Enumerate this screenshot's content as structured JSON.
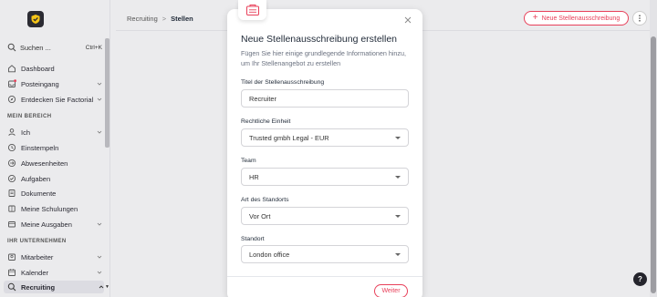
{
  "sidebar": {
    "search_label": "Suchen ...",
    "search_shortcut": "Ctrl+K",
    "items_top": [
      {
        "label": "Dashboard",
        "icon": "home-icon"
      },
      {
        "label": "Posteingang",
        "icon": "inbox-icon",
        "chevron": true,
        "dot": true
      },
      {
        "label": "Entdecken Sie Factorial",
        "icon": "compass-icon",
        "chevron": true
      }
    ],
    "section_mein": "MEIN BEREICH",
    "items_mein": [
      {
        "label": "Ich",
        "icon": "user-icon",
        "chevron": true
      },
      {
        "label": "Einstempeln",
        "icon": "clock-icon"
      },
      {
        "label": "Abwesenheiten",
        "icon": "plane-icon"
      },
      {
        "label": "Aufgaben",
        "icon": "check-circle-icon"
      },
      {
        "label": "Dokumente",
        "icon": "document-icon"
      },
      {
        "label": "Meine Schulungen",
        "icon": "book-icon"
      },
      {
        "label": "Meine Ausgaben",
        "icon": "receipt-icon",
        "chevron": true
      }
    ],
    "section_unternehmen": "IHR UNTERNEHMEN",
    "items_unternehmen": [
      {
        "label": "Mitarbeiter",
        "icon": "people-icon",
        "chevron": true
      },
      {
        "label": "Kalender",
        "icon": "calendar-icon",
        "chevron": true
      },
      {
        "label": "Recruiting",
        "icon": "search-person-icon",
        "chevron": true,
        "active": true
      }
    ]
  },
  "header": {
    "breadcrumb_parent": "Recruiting",
    "breadcrumb_separator": ">",
    "breadcrumb_current": "Stellen",
    "new_button_label": "Neue Stellenausschreibung"
  },
  "modal": {
    "title": "Neue Stellenausschreibung erstellen",
    "subtitle": "Fügen Sie hier einige grundlegende Informationen hinzu, um Ihr Stellenangebot zu erstellen",
    "fields": {
      "title_label": "Titel der Stellenausschreibung",
      "title_value": "Recruiter",
      "entity_label": "Rechtliche Einheit",
      "entity_value": "Trusted gmbh Legal - EUR",
      "team_label": "Team",
      "team_value": "HR",
      "location_type_label": "Art des Standorts",
      "location_type_value": "Vor Ort",
      "location_label": "Standort",
      "location_value": "London office"
    },
    "next_button_label": "Weiter"
  },
  "help_label": "?",
  "colors": {
    "accent": "#e8405a",
    "logo_bg": "#2b2b33",
    "logo_fg": "#f5c518"
  }
}
